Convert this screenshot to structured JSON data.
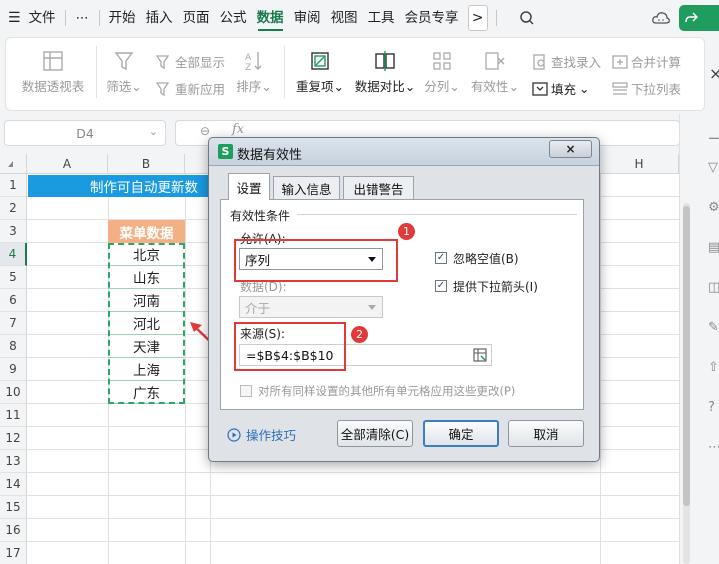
{
  "menu": {
    "items": [
      "文件",
      "开始",
      "插入",
      "页面",
      "公式",
      "数据",
      "审阅",
      "视图",
      "工具",
      "会员专享"
    ],
    "active": "数据",
    "more_glyph": ">"
  },
  "ribbon": {
    "pivot": "数据透视表",
    "filter": "筛选",
    "show_all": "全部显示",
    "reapply": "重新应用",
    "sort": "排序",
    "duplicates": "重复项",
    "compare": "数据对比",
    "split": "分列",
    "validity": "有效性",
    "lookup": "查找录入",
    "fill": "填充",
    "merge": "合并计算",
    "dropdown": "下拉列表",
    "caret": "⌄",
    "close_glyph": "×"
  },
  "formula_bar": {
    "cell_ref": "D4",
    "fx": "fx",
    "zoom_glyph": "⊖"
  },
  "sheet": {
    "columns": [
      "A",
      "B",
      "H"
    ],
    "rows": [
      "1",
      "2",
      "3",
      "4",
      "5",
      "6",
      "7",
      "8",
      "9",
      "10",
      "11",
      "12",
      "13",
      "14",
      "15",
      "16",
      "17"
    ],
    "title_text": "制作可自动更新数",
    "header": "菜单数据",
    "values": [
      "北京",
      "山东",
      "河南",
      "河北",
      "天津",
      "上海",
      "广东"
    ]
  },
  "dialog": {
    "title": "数据有效性",
    "close_glyph": "×",
    "logo": "S",
    "tabs": [
      "设置",
      "输入信息",
      "出错警告"
    ],
    "active_tab": "设置",
    "group_label": "有效性条件",
    "allow_label": "允许(A):",
    "allow_value": "序列",
    "data_label": "数据(D):",
    "data_value": "介于",
    "ignore_blank": "忽略空值(B)",
    "dropdown_arrow": "提供下拉箭头(I)",
    "source_label": "来源(S):",
    "source_value": "=$B$4:$B$10",
    "apply_all": "对所有同样设置的其他所有单元格应用这些更改(P)",
    "tips": "操作技巧",
    "clear_all": "全部清除(C)",
    "ok": "确定",
    "cancel": "取消",
    "check_mark": "✓",
    "badge1": "1",
    "badge2": "2"
  },
  "colors": {
    "accent": "#1a7a4c",
    "title_fill": "#1a9be0",
    "header_fill": "#f4b085",
    "annotation": "#e03a3a"
  }
}
